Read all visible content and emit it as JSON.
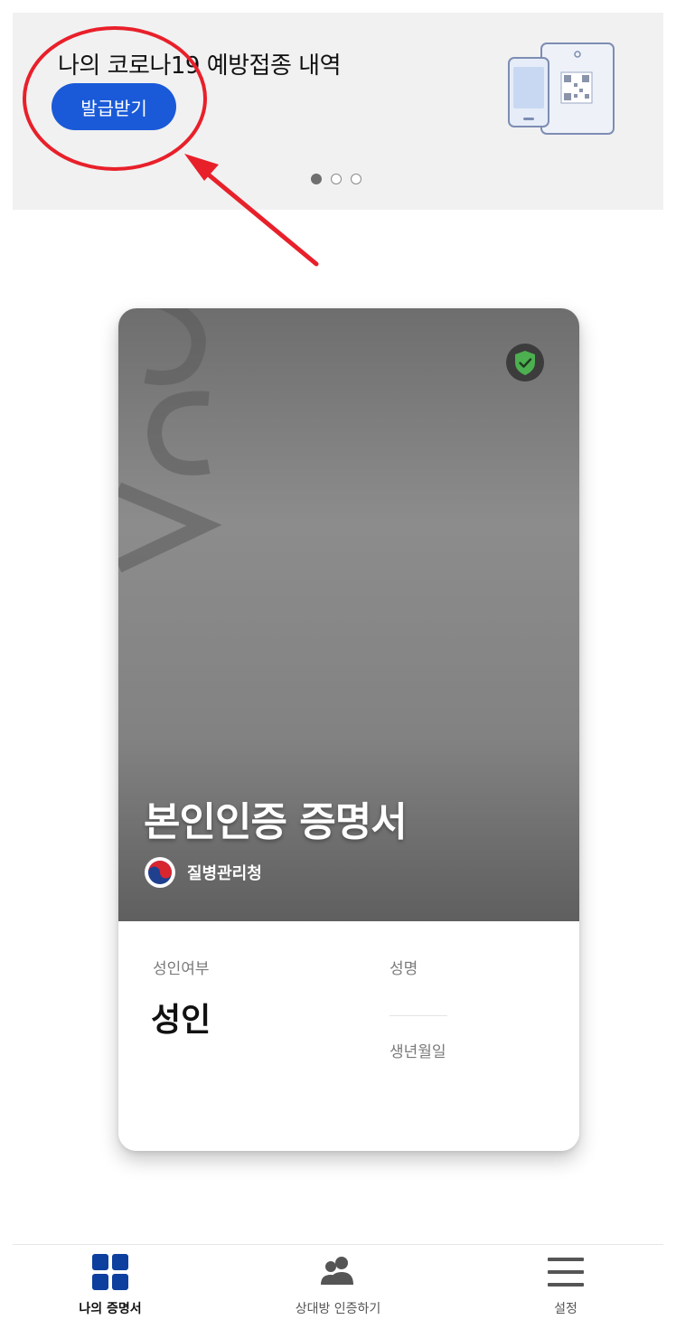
{
  "banner": {
    "title": "나의 코로나19 예방접종 내역",
    "issue_button": "발급받기",
    "pager": {
      "count": 3,
      "active_index": 0
    },
    "illustration": "phone-qr-illustration"
  },
  "annotation": {
    "circle_color": "#e8202a",
    "arrow_color": "#e8202a"
  },
  "card": {
    "title": "본인인증 증명서",
    "agency": "질병관리청",
    "verified_icon": "shield-check-icon",
    "fields": {
      "adult_label": "성인여부",
      "adult_value": "성인",
      "name_label": "성명",
      "name_value": "",
      "birth_label": "생년월일",
      "birth_value": ""
    }
  },
  "nav": {
    "items": [
      {
        "label": "나의 증명서",
        "icon": "grid-icon",
        "active": true
      },
      {
        "label": "상대방 인증하기",
        "icon": "people-icon",
        "active": false
      },
      {
        "label": "설정",
        "icon": "menu-icon",
        "active": false
      }
    ]
  },
  "colors": {
    "accent": "#1a5ad8",
    "nav_active": "#0d3f9e",
    "shield_green": "#4caf50"
  }
}
